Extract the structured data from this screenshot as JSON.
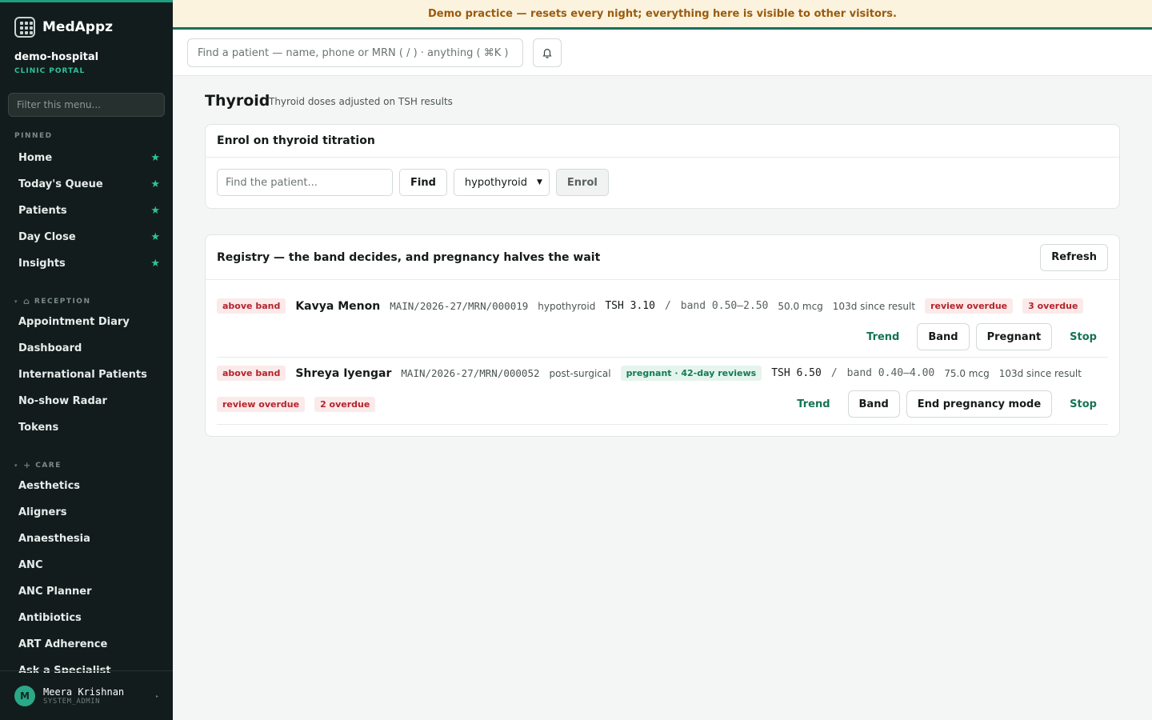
{
  "banner": {
    "text": "Demo practice — resets every night; everything here is visible to other visitors."
  },
  "brand": {
    "name": "MedAppz"
  },
  "org": {
    "name": "demo-hospital",
    "sub": "CLINIC PORTAL"
  },
  "menu_filter": {
    "placeholder": "Filter this menu..."
  },
  "sections": {
    "pinned": "PINNED",
    "reception": "RECEPTION",
    "care": "CARE"
  },
  "pinned_items": [
    {
      "label": "Home"
    },
    {
      "label": "Today's Queue"
    },
    {
      "label": "Patients"
    },
    {
      "label": "Day Close"
    },
    {
      "label": "Insights"
    }
  ],
  "reception_items": [
    {
      "label": "Appointment Diary"
    },
    {
      "label": "Dashboard"
    },
    {
      "label": "International Patients"
    },
    {
      "label": "No-show Radar"
    },
    {
      "label": "Tokens"
    }
  ],
  "care_items": [
    {
      "label": "Aesthetics"
    },
    {
      "label": "Aligners"
    },
    {
      "label": "Anaesthesia"
    },
    {
      "label": "ANC"
    },
    {
      "label": "ANC Planner"
    },
    {
      "label": "Antibiotics"
    },
    {
      "label": "ART Adherence"
    },
    {
      "label": "Ask a Specialist"
    }
  ],
  "user": {
    "initial": "M",
    "name": "Meera Krishnan",
    "role": "SYSTEM_ADMIN"
  },
  "search": {
    "placeholder": "Find a patient — name, phone or MRN ( / ) · anything ( ⌘K )"
  },
  "page": {
    "title": "Thyroid",
    "subtitle": "Thyroid doses adjusted on TSH results"
  },
  "enrol": {
    "title": "Enrol on thyroid titration",
    "patient_placeholder": "Find the patient...",
    "find_label": "Find",
    "condition_value": "hypothyroid",
    "enrol_label": "Enrol"
  },
  "registry": {
    "title": "Registry — the band decides, and pregnancy halves the wait",
    "refresh_label": "Refresh",
    "rows": [
      {
        "status_tag": "above band",
        "name": "Kavya Menon",
        "mrn": "MAIN/2026-27/MRN/000019",
        "condition": "hypothyroid",
        "tsh": "TSH 3.10",
        "sep": "/",
        "band": "band 0.50–2.50",
        "dose": "50.0 mcg",
        "since": "103d since result",
        "review_tag": "review overdue",
        "overdue_tag": "3 overdue",
        "actions": {
          "trend": "Trend",
          "band": "Band",
          "pregnant": "Pregnant",
          "stop": "Stop"
        }
      },
      {
        "status_tag": "above band",
        "name": "Shreya Iyengar",
        "mrn": "MAIN/2026-27/MRN/000052",
        "condition": "post-surgical",
        "pregnancy_tag": "pregnant · 42-day reviews",
        "tsh": "TSH 6.50",
        "sep": "/",
        "band": "band 0.40–4.00",
        "dose": "75.0 mcg",
        "since": "103d since result",
        "review_tag": "review overdue",
        "overdue_tag": "2 overdue",
        "actions": {
          "trend": "Trend",
          "band": "Band",
          "end_pregnancy": "End pregnancy mode",
          "stop": "Stop"
        }
      }
    ]
  },
  "colors": {
    "accent": "#1f9e7f",
    "sidebar_bg": "#121c1c",
    "banner_bg": "#fcf3df",
    "banner_text": "#9a5b0d",
    "danger": "#b4232a"
  }
}
